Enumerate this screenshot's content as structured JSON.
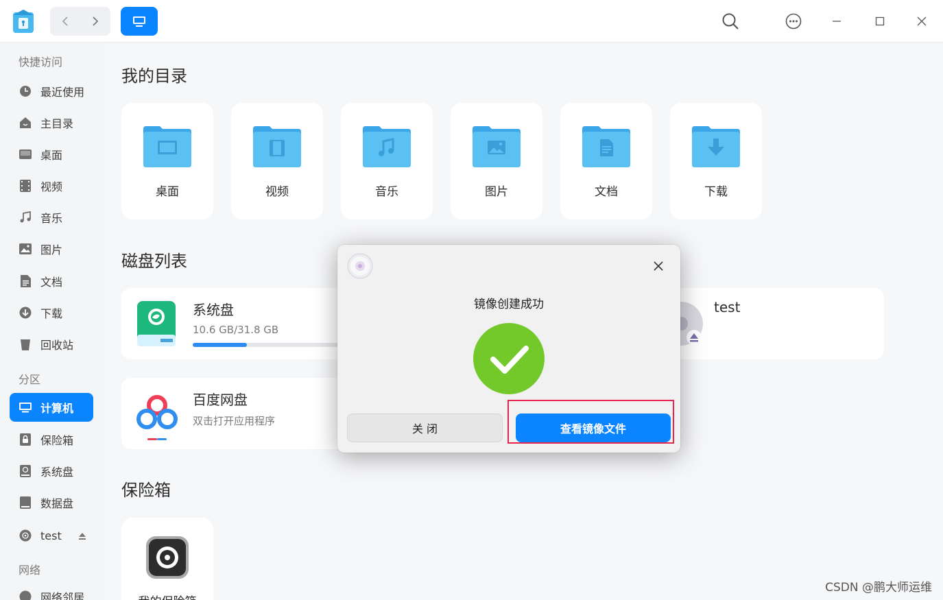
{
  "sidebar": {
    "sections": {
      "quick_access": "快捷访问",
      "partitions": "分区",
      "network": "网络"
    },
    "items": [
      {
        "label": "最近使用",
        "icon": "clock-icon"
      },
      {
        "label": "主目录",
        "icon": "home-icon"
      },
      {
        "label": "桌面",
        "icon": "desktop-icon"
      },
      {
        "label": "视频",
        "icon": "video-icon"
      },
      {
        "label": "音乐",
        "icon": "music-icon"
      },
      {
        "label": "图片",
        "icon": "image-icon"
      },
      {
        "label": "文档",
        "icon": "document-icon"
      },
      {
        "label": "下载",
        "icon": "download-icon"
      },
      {
        "label": "回收站",
        "icon": "trash-icon"
      },
      {
        "label": "计算机",
        "icon": "computer-icon",
        "active": true
      },
      {
        "label": "保险箱",
        "icon": "vault-icon"
      },
      {
        "label": "系统盘",
        "icon": "system-disk-icon"
      },
      {
        "label": "数据盘",
        "icon": "data-disk-icon"
      },
      {
        "label": "test",
        "icon": "disc-icon"
      },
      {
        "label": "网络邻居",
        "icon": "network-icon"
      }
    ]
  },
  "main": {
    "my_directories_title": "我的目录",
    "directories": [
      "桌面",
      "视频",
      "音乐",
      "图片",
      "文档",
      "下载"
    ],
    "disk_list_title": "磁盘列表",
    "disks": {
      "system": {
        "name": "系统盘",
        "usage": "10.6 GB/31.8 GB",
        "usage_fraction": 0.333
      },
      "test": {
        "name": "test"
      },
      "baidu": {
        "name": "百度网盘",
        "subtitle": "双击打开应用程序"
      }
    },
    "vault_title": "保险箱",
    "vault_card_label": "我的保险箱"
  },
  "dialog": {
    "title": "镜像创建成功",
    "close_button": "关 闭",
    "view_button": "查看镜像文件"
  },
  "watermark": "CSDN @鹏大师运维",
  "colors": {
    "accent": "#0a84ff",
    "success": "#73c82a",
    "folder": "#5bc0f2",
    "highlight": "#e5254b"
  }
}
